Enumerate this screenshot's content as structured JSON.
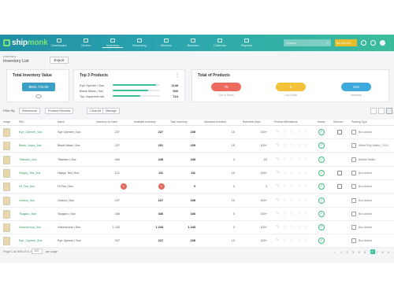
{
  "app": {
    "logo_prefix": "ship",
    "logo_suffix": "monk"
  },
  "nav": [
    {
      "label": "Dashboard",
      "icon": "dashboard-icon"
    },
    {
      "label": "Orders",
      "icon": "orders-icon"
    },
    {
      "label": "Inventory",
      "icon": "inventory-icon"
    },
    {
      "label": "Receiving",
      "icon": "receiving-icon"
    },
    {
      "label": "Returns",
      "icon": "returns-icon"
    },
    {
      "label": "Batches",
      "icon": "batches-icon"
    },
    {
      "label": "Calendar",
      "icon": "calendar-icon"
    },
    {
      "label": "Reports",
      "icon": "reports-icon"
    }
  ],
  "search": {
    "placeholder": "Search"
  },
  "balance": "$4,510.00",
  "header": {
    "breadcrumb": "Inventory",
    "title": "Inventory List",
    "export_label": "Export"
  },
  "cards": {
    "inventory_value": {
      "title": "Total Inventory Value",
      "value": "$582,733.00"
    },
    "top3": {
      "title": "Top 3 Products",
      "items": [
        {
          "name": "Eye Opener | 5oz",
          "value": "1148",
          "fill": 0.92
        },
        {
          "name": "Black Mass | 5oz",
          "value": "933",
          "fill": 0.75
        },
        {
          "name": "Top Japanese set",
          "value": "724",
          "fill": 0.58
        }
      ]
    },
    "totals": {
      "title": "Total of Products",
      "out_of_stock": {
        "value": "76",
        "label": "Out of Stock",
        "color": "#ec6b5e"
      },
      "low_stock": {
        "value": "8",
        "label": "Low Stock",
        "color": "#f2c23a"
      },
      "inventory": {
        "value": "543",
        "label": "Inventory",
        "color": "#3da9dd"
      }
    }
  },
  "filters": {
    "label": "Filter By",
    "chips": [
      "Warehouse",
      "Product Records",
      "Clear All",
      "Manage"
    ]
  },
  "columns": [
    "Image",
    "SKU",
    "Name",
    "Inventory on Hand",
    "Available Inventory",
    "Total Inventory",
    "Allocated Inventory",
    "Retention Days",
    "Product Affirmations",
    "Status",
    "Secured",
    "Packing Type"
  ],
  "rows": [
    {
      "sku": "Eye_Opener_5oz",
      "name": "Eye Opener | 5oz",
      "on_hand": "237",
      "available": "227",
      "total": "235",
      "allocated": "10",
      "retention": "100+",
      "packing": "Box Added"
    },
    {
      "sku": "Black_Mass_5oz",
      "name": "Black Mass | 5oz",
      "on_hand": "237",
      "available": "201",
      "total": "235",
      "allocated": "15",
      "retention": "100+",
      "packing": "White Poly Mailer | 7x10"
    },
    {
      "sku": "Titanium_5oz",
      "name": "Titanium | 5oz",
      "on_hand": "454",
      "available": "445",
      "total": "445",
      "allocated": "0",
      "retention": "24",
      "packing": "Bubble Mailer"
    },
    {
      "sku": "Happy_Tea_5oz",
      "name": "Happy Tea | 5oz",
      "on_hand": "121",
      "available": "111",
      "total": "111",
      "allocated": "10",
      "retention": "100+",
      "packing": "Box Added"
    },
    {
      "sku": "Hi_Tea_5oz",
      "name": "Hi Tea | 5oz",
      "on_hand": "0",
      "available": "0",
      "total": "0",
      "allocated": "0",
      "retention": "0",
      "packing": "Box Added",
      "out": true
    },
    {
      "sku": "Unison_5oz",
      "name": "Unison | 5oz",
      "on_hand": "237",
      "available": "227",
      "total": "235",
      "allocated": "10",
      "retention": "100+",
      "packing": "Box Added"
    },
    {
      "sku": "Tsugaro_5oz",
      "name": "Tsugaro | 5oz",
      "on_hand": "346",
      "available": "346",
      "total": "346",
      "allocated": "0",
      "retention": "100+",
      "packing": "Box Added"
    },
    {
      "sku": "Voluminous_5oz",
      "name": "Voluminous | 5oz",
      "on_hand": "1 243",
      "available": "1 243",
      "total": "1 243",
      "allocated": "0",
      "retention": "100+",
      "packing": "Box Added"
    },
    {
      "sku": "Eye_Opener_5oz",
      "name": "Eye Opener | 5oz",
      "on_hand": "237",
      "available": "227",
      "total": "235",
      "allocated": "10",
      "retention": "100+",
      "packing": "Box Added"
    }
  ],
  "footer": {
    "pages_text": "Page 1 as 565 of 11 rows",
    "per_page": "100",
    "per_page_suffix": "per page",
    "pages": [
      "1",
      "2",
      "3",
      "4",
      "5",
      "6",
      "7",
      "8",
      "9"
    ],
    "active_page": "6"
  }
}
